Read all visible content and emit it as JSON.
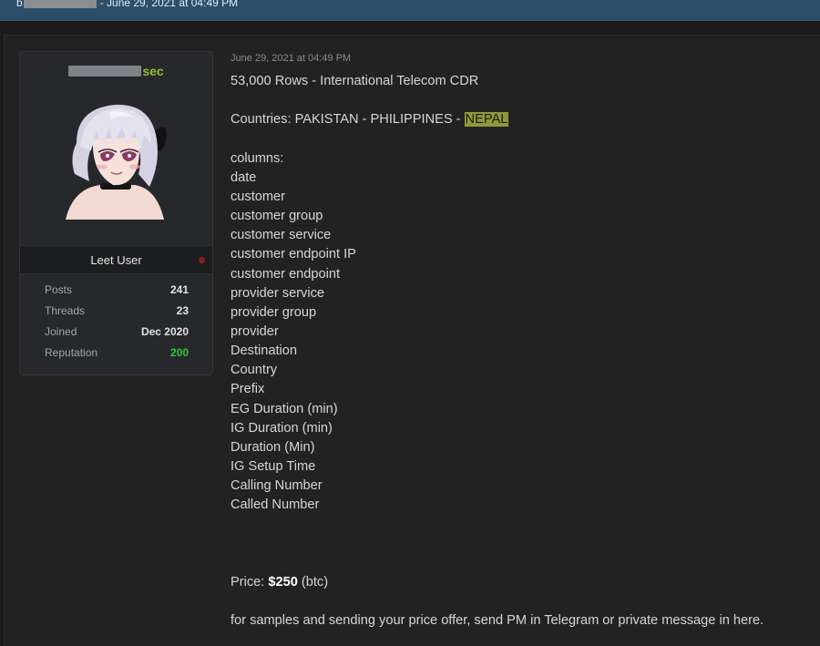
{
  "header": {
    "byline_prefix": "b",
    "byline_suffix": "- June 29, 2021 at 04:49 PM"
  },
  "user": {
    "username_visible": "sec",
    "rank": "Leet User",
    "stats": [
      {
        "label": "Posts",
        "value": "241"
      },
      {
        "label": "Threads",
        "value": "23"
      },
      {
        "label": "Joined",
        "value": "Dec 2020"
      },
      {
        "label": "Reputation",
        "value": "200"
      }
    ]
  },
  "post": {
    "date": "June 29, 2021 at 04:49 PM",
    "title": "53,000 Rows - International Telecom CDR",
    "countries_prefix": "Countries: PAKISTAN - PHILIPPINES - ",
    "countries_highlight": "NEPAL",
    "columns_heading": "columns:",
    "columns": [
      "date",
      "customer",
      "customer group",
      "customer service",
      "customer endpoint IP",
      "customer endpoint",
      "provider service",
      "provider group",
      "provider",
      "Destination",
      "Country",
      "Prefix",
      "EG Duration (min)",
      "IG Duration (min)",
      "Duration (Min)",
      "IG Setup Time",
      "Calling Number",
      "Called Number"
    ],
    "price_label": "Price:",
    "price_value": "$250",
    "price_currency": "(btc)",
    "footer": "for samples and sending your price offer, send PM in Telegram or private message in here."
  },
  "colors": {
    "header_bar": "#2d4e68",
    "username": "#8fbf3b",
    "reputation": "#36c33b",
    "highlight": "#8f9a37",
    "status_dot": "#8c1d1d"
  }
}
